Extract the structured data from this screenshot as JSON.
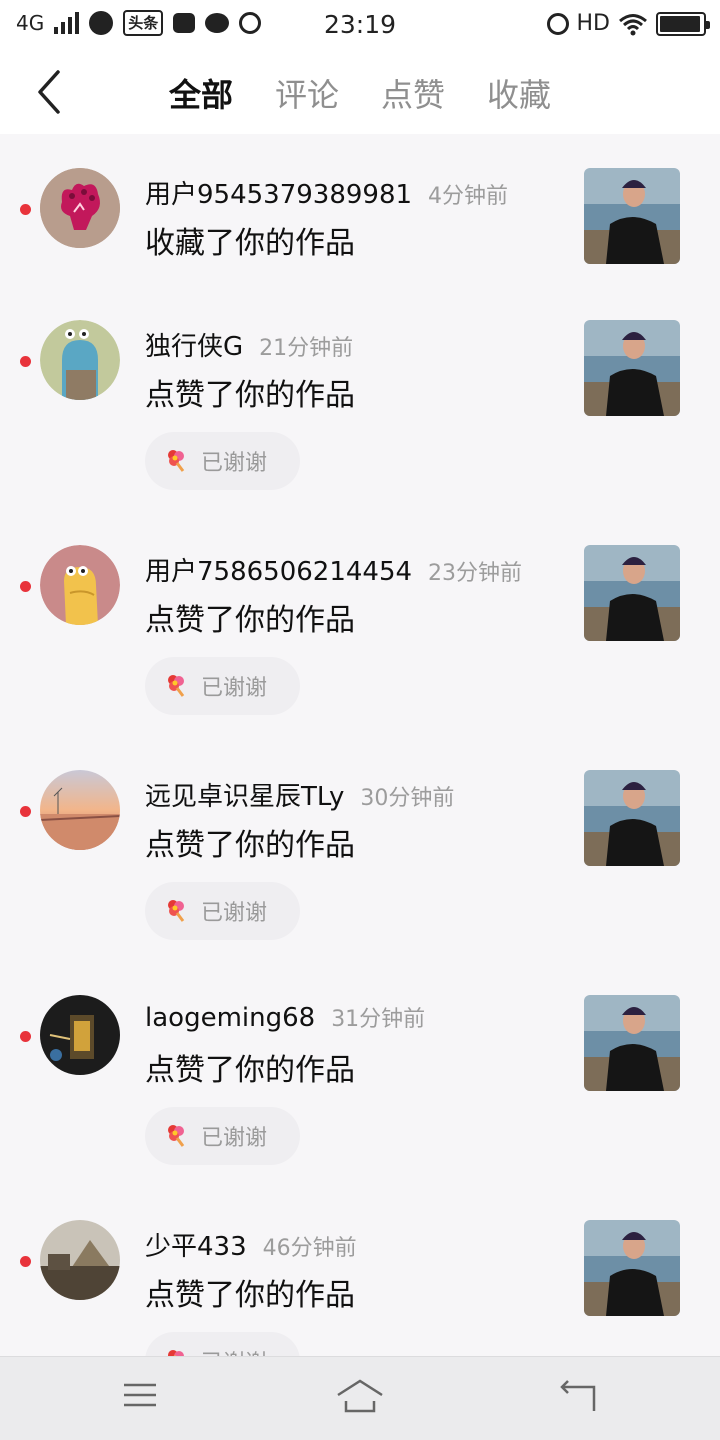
{
  "status_bar": {
    "network": "4G",
    "app_badge": "头条",
    "time": "23:19",
    "hd": "HD",
    "battery_level": 0.95
  },
  "header": {
    "back_icon": "chevron-left-icon",
    "tabs": [
      {
        "label": "全部",
        "active": true
      },
      {
        "label": "评论",
        "active": false
      },
      {
        "label": "点赞",
        "active": false
      },
      {
        "label": "收藏",
        "active": false
      }
    ]
  },
  "notifications": [
    {
      "user": "用户9545379389981",
      "time": "4分钟前",
      "action": "收藏了你的作品",
      "thanks": ""
    },
    {
      "user": "独行侠G",
      "time": "21分钟前",
      "action": "点赞了你的作品",
      "thanks": "已谢谢"
    },
    {
      "user": "用户7586506214454",
      "time": "23分钟前",
      "action": "点赞了你的作品",
      "thanks": "已谢谢"
    },
    {
      "user": "远见卓识星辰TLy",
      "time": "30分钟前",
      "action": "点赞了你的作品",
      "thanks": "已谢谢"
    },
    {
      "user": "laogeming68",
      "time": "31分钟前",
      "action": "点赞了你的作品",
      "thanks": "已谢谢"
    },
    {
      "user": "少平433",
      "time": "46分钟前",
      "action": "点赞了你的作品",
      "thanks": "已谢谢"
    }
  ],
  "colors": {
    "unread_dot": "#e8333b",
    "active_tab": "#111111",
    "inactive_tab": "#8f8f8f",
    "timestamp": "#9c9c9c"
  },
  "bottom_nav": {
    "menu_icon": "menu-icon",
    "home_icon": "home-icon",
    "back_icon": "return-icon"
  }
}
